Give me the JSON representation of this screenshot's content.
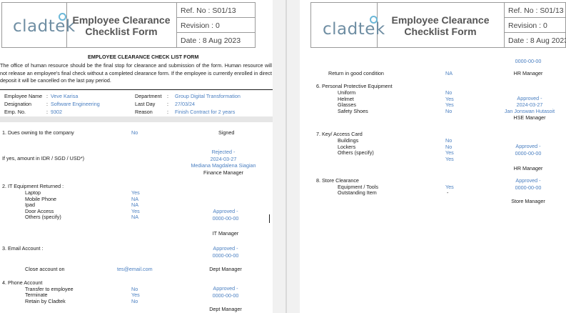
{
  "header": {
    "logo": "cladtek",
    "title_line1": "Employee Clearance",
    "title_line2": "Checklist Form",
    "ref": "Ref. No  : S01/13",
    "revision": "Revision : 0",
    "date": "Date     : 8 Aug 2023"
  },
  "form": {
    "heading": "EMPLOYEE CLEARANCE CHECK LIST FORM",
    "intro": "The office of human resource should be the final stop for clearance and submission of the form. Human resource will not release an employee's final check without a completed clearance form. If the employee is currently enrolled in direct deposit it will be cancelled on the last pay period."
  },
  "employee": {
    "name_label": "Employee Name",
    "name_value": "Veve Karisa",
    "designation_label": "Designation",
    "designation_value": "Software Engineering",
    "empno_label": "Emp. No.",
    "empno_value": "9302",
    "department_label": "Department",
    "department_value": "Group Digital Transformation",
    "lastday_label": "Last Day",
    "lastday_value": "27/03/24",
    "reason_label": "Reason",
    "reason_value": "Finish Contract for 2 years",
    "colon": ":"
  },
  "s1": {
    "title": "1. Dues owning to the company",
    "value": "No",
    "signed": "Signed",
    "amount_label": "If yes, amount in IDR / SGD / USD*)",
    "status": "Rejected -",
    "date": "2024-03-27",
    "person": "Mediana Magdalena Siagian",
    "role": "Finance Manager"
  },
  "s2": {
    "title": "2. IT Equipment Returned :",
    "items": [
      {
        "label": "Laptop",
        "value": "Yes"
      },
      {
        "label": "Mobile Phone",
        "value": "NA"
      },
      {
        "label": "Ipad",
        "value": "NA"
      },
      {
        "label": "Door Access",
        "value": "Yes"
      },
      {
        "label": "Others (specify)",
        "value": "NA"
      }
    ],
    "status": "Approved -",
    "date": "0000-00-00",
    "role": "IT Manager"
  },
  "s3": {
    "title": "3. Email Account :",
    "status": "Approved -",
    "date": "0000-00-00",
    "close_label": "Close account on",
    "close_value": "tes@email.com",
    "role": "Dept Manager"
  },
  "s4": {
    "title": "4. Phone Account",
    "items": [
      {
        "label": "Transfer to employee",
        "value": "No"
      },
      {
        "label": "Terminate",
        "value": "Yes"
      },
      {
        "label": "Retain by Cladtek",
        "value": "No"
      }
    ],
    "status": "Approved -",
    "date": "0000-00-00",
    "role": "Dept Manager"
  },
  "s5": {
    "top_date": "0000-00-00",
    "label": "Return in good condition",
    "value": "NA",
    "role": "HR Manager"
  },
  "s6": {
    "title": "6. Personal Protective Equipment",
    "items": [
      {
        "label": "Uniform",
        "value": "No"
      },
      {
        "label": "Helmet",
        "value": "Yes"
      },
      {
        "label": "Glasses",
        "value": "Yes"
      },
      {
        "label": "Safety Shoes",
        "value": "No"
      }
    ],
    "status": "Approved -",
    "date": "2024-03-27",
    "person": "Jan Jonswan Hutasoit",
    "role": "HSE Manager"
  },
  "s7": {
    "title": "7. Key/ Access Card",
    "items": [
      {
        "label": "Buildings",
        "value": "No"
      },
      {
        "label": "Lockers",
        "value": "No"
      },
      {
        "label": "Others (specify)",
        "value": "Yes"
      },
      {
        "label": "",
        "value": "Yes"
      }
    ],
    "status": "Approved -",
    "date": "0000-00-00",
    "role": "HR Manager"
  },
  "s8": {
    "title": "8. Store Clearance",
    "items": [
      {
        "label": "Equipment / Tools",
        "value": "Yes"
      },
      {
        "label": "Outstanding Item",
        "value": "-"
      }
    ],
    "status": "Approved -",
    "date": "0000-00-00",
    "role": "Store Manager"
  }
}
